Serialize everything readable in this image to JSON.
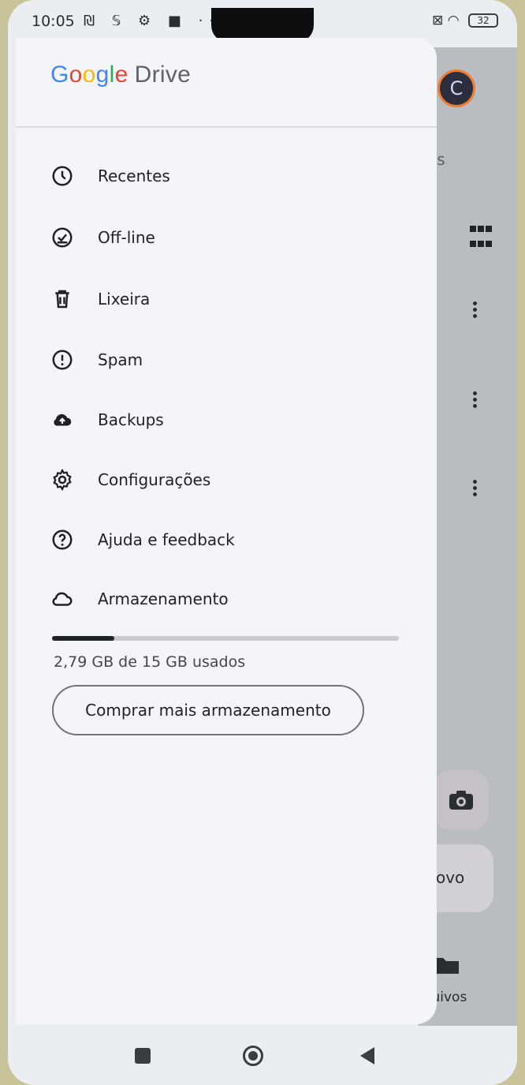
{
  "status_bar": {
    "time": "10:05",
    "icons": "₪ 𝕊 ⚙ ■ ···",
    "right_icons": "⊠ ◠",
    "battery": "32"
  },
  "background_app": {
    "avatar_letter": "C",
    "partial_text_1": "es",
    "partial_text_2": "Novo",
    "partial_text_3": "rquivos"
  },
  "drawer": {
    "logo": {
      "g1": "G",
      "g2": "o",
      "g3": "o",
      "g4": "g",
      "g5": "l",
      "g6": "e",
      "drive": "Drive"
    },
    "items": [
      {
        "label": "Recentes",
        "icon": "clock-icon"
      },
      {
        "label": "Off-line",
        "icon": "offline-check-icon"
      },
      {
        "label": "Lixeira",
        "icon": "trash-icon"
      },
      {
        "label": "Spam",
        "icon": "spam-icon"
      },
      {
        "label": "Backups",
        "icon": "cloud-upload-icon"
      },
      {
        "label": "Configurações",
        "icon": "gear-icon"
      },
      {
        "label": "Ajuda e feedback",
        "icon": "help-icon"
      },
      {
        "label": "Armazenamento",
        "icon": "cloud-icon"
      }
    ],
    "storage": {
      "used_fraction": 0.18,
      "usage_text": "2,79 GB de 15 GB usados"
    },
    "buy_button": "Comprar mais armazenamento"
  }
}
